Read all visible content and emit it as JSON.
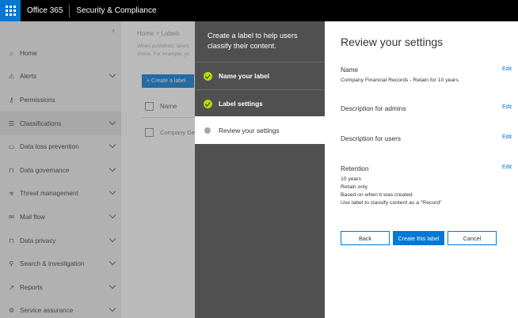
{
  "topbar": {
    "app_name": "Office 365",
    "section_name": "Security & Compliance"
  },
  "leftnav": {
    "collapse_glyph": "‹",
    "items": [
      {
        "label": "Home",
        "icon": "home-icon",
        "glyph": "⌂",
        "chevron": false
      },
      {
        "label": "Alerts",
        "icon": "alert-icon",
        "glyph": "⚠",
        "chevron": true
      },
      {
        "label": "Permissions",
        "icon": "key-icon",
        "glyph": "⚷",
        "chevron": false
      },
      {
        "label": "Classifications",
        "icon": "list-icon",
        "glyph": "☰",
        "chevron": true,
        "active": true
      },
      {
        "label": "Data loss prevention",
        "icon": "document-icon",
        "glyph": "▭",
        "chevron": true
      },
      {
        "label": "Data governance",
        "icon": "lock-icon",
        "glyph": "⊓",
        "chevron": true
      },
      {
        "label": "Threat management",
        "icon": "biohazard-icon",
        "glyph": "☣",
        "chevron": true
      },
      {
        "label": "Mail flow",
        "icon": "mail-icon",
        "glyph": "✉",
        "chevron": true
      },
      {
        "label": "Data privacy",
        "icon": "lock-icon",
        "glyph": "⊓",
        "chevron": true
      },
      {
        "label": "Search & investigation",
        "icon": "search-icon",
        "glyph": "⚲",
        "chevron": true
      },
      {
        "label": "Reports",
        "icon": "chart-icon",
        "glyph": "↗",
        "chevron": true
      },
      {
        "label": "Service assurance",
        "icon": "gear-icon",
        "glyph": "⚙",
        "chevron": true
      }
    ]
  },
  "background": {
    "breadcrumb": "Home  >  Labels",
    "description": "When published, labels chose. For example, yo",
    "create_button": "+ Create a label",
    "column_name": "Name",
    "row_name": "Company Ge"
  },
  "wizard": {
    "intro": "Create a label to help users classify their content.",
    "steps": [
      {
        "label": "Name your label",
        "state": "done"
      },
      {
        "label": "Label settings",
        "state": "done"
      },
      {
        "label": "Review your settings",
        "state": "current"
      }
    ],
    "review_title": "Review your settings",
    "edit_label": "Edit",
    "sections": {
      "name": {
        "title": "Name",
        "value": "Company Financial Records - Retain for 10 years"
      },
      "admins": {
        "title": "Description for admins"
      },
      "users": {
        "title": "Description for users"
      },
      "retention": {
        "title": "Retention",
        "lines": [
          "10 years",
          "Retain only",
          "Based on when it was created",
          "Use label to classify content as a \"Record\""
        ]
      }
    },
    "buttons": {
      "back": "Back",
      "create": "Create this label",
      "cancel": "Cancel"
    }
  },
  "colors": {
    "accent": "#0078d4",
    "done_check": "#bad80a",
    "wizard_panel": "#505050"
  }
}
